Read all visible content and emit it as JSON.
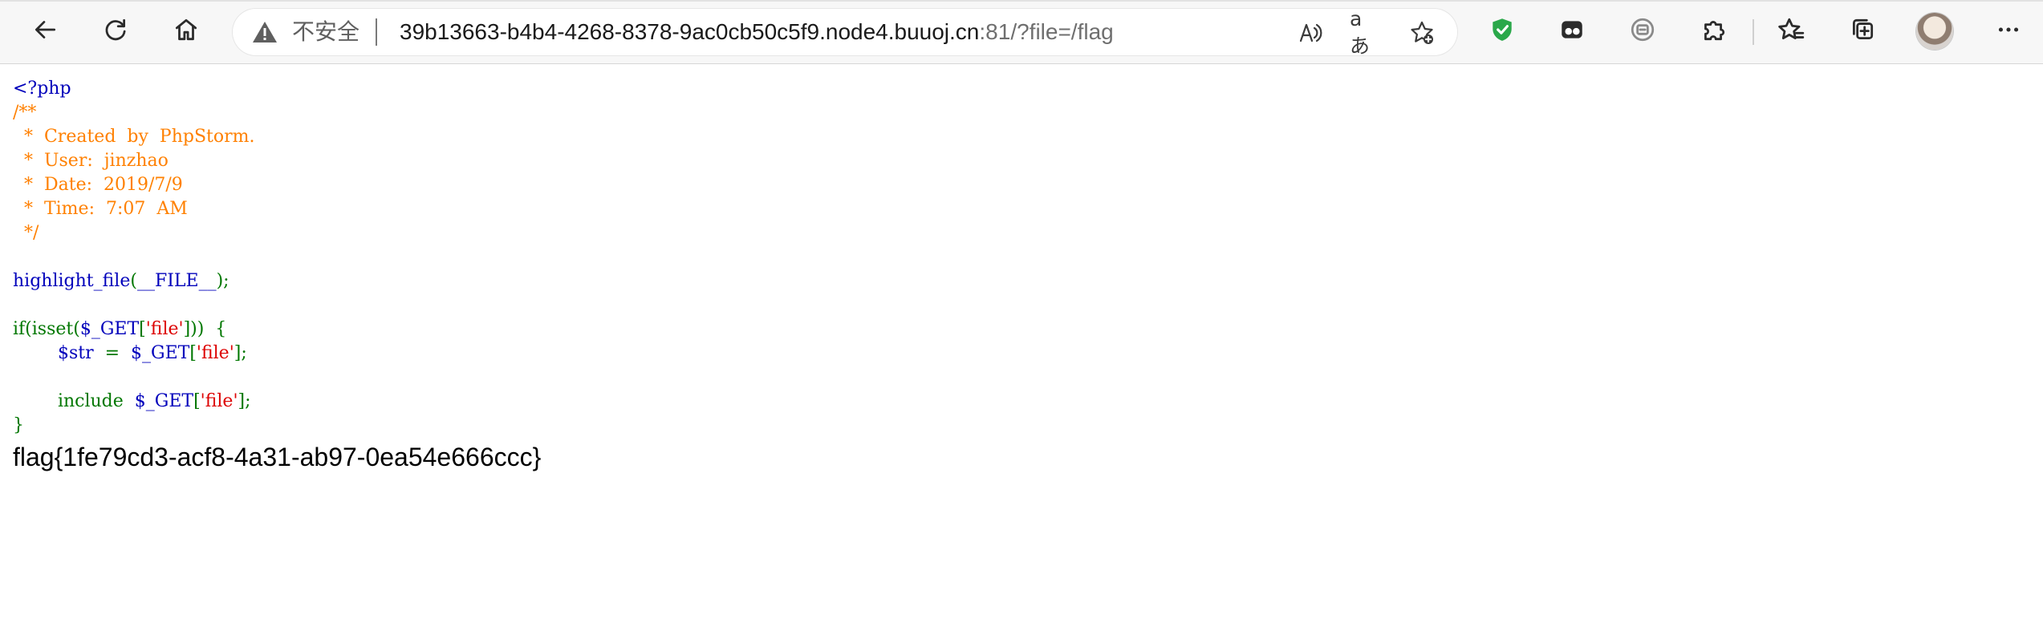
{
  "browser": {
    "security_label": "不安全",
    "url_host": "39b13663-b4b4-4268-8378-9ac0cb50c5f9.node4.buuoj.cn",
    "url_rest": ":81/?file=/flag",
    "icons": {
      "back": "back-arrow-icon",
      "refresh": "refresh-icon",
      "home": "home-icon",
      "warning": "warning-triangle-icon",
      "read_aloud": "read-aloud-icon",
      "translate": "translate-icon",
      "add_favorite": "add-favorite-icon",
      "shield_extension": "shield-icon",
      "extension_one": "tab-extension-icon",
      "extension_two": "circle-extension-icon",
      "extensions": "puzzle-icon",
      "favorites": "favorites-icon",
      "collections": "collections-icon",
      "profile": "profile-avatar",
      "more": "more-icon"
    },
    "colors": {
      "toolbar_bg": "#f7f7f7",
      "shield_green": "#2aa84a"
    }
  },
  "source": {
    "colors": {
      "default": "#0000bb",
      "comment": "#ff8000",
      "keyword": "#007700",
      "string": "#dd0000"
    },
    "lines": [
      [
        {
          "t": "<?php",
          "c": "default"
        }
      ],
      [
        {
          "t": "/**",
          "c": "comment"
        }
      ],
      [
        {
          "t": "  *  Created  by  PhpStorm.",
          "c": "comment"
        }
      ],
      [
        {
          "t": "  *  User:  jinzhao",
          "c": "comment"
        }
      ],
      [
        {
          "t": "  *  Date:  2019/7/9",
          "c": "comment"
        }
      ],
      [
        {
          "t": "  *  Time:  7:07  AM",
          "c": "comment"
        }
      ],
      [
        {
          "t": "  */",
          "c": "comment"
        }
      ],
      [
        {
          "t": "",
          "c": "default"
        }
      ],
      [
        {
          "t": "highlight_file",
          "c": "default"
        },
        {
          "t": "(",
          "c": "keyword"
        },
        {
          "t": "__FILE__",
          "c": "default"
        },
        {
          "t": ");",
          "c": "keyword"
        }
      ],
      [
        {
          "t": "",
          "c": "default"
        }
      ],
      [
        {
          "t": "if(isset(",
          "c": "keyword"
        },
        {
          "t": "$_GET",
          "c": "default"
        },
        {
          "t": "[",
          "c": "keyword"
        },
        {
          "t": "'file'",
          "c": "string"
        },
        {
          "t": "]))  {",
          "c": "keyword"
        }
      ],
      [
        {
          "t": "        ",
          "c": "keyword"
        },
        {
          "t": "$str  ",
          "c": "default"
        },
        {
          "t": "=  ",
          "c": "keyword"
        },
        {
          "t": "$_GET",
          "c": "default"
        },
        {
          "t": "[",
          "c": "keyword"
        },
        {
          "t": "'file'",
          "c": "string"
        },
        {
          "t": "];",
          "c": "keyword"
        }
      ],
      [
        {
          "t": "",
          "c": "default"
        }
      ],
      [
        {
          "t": "        include  ",
          "c": "keyword"
        },
        {
          "t": "$_GET",
          "c": "default"
        },
        {
          "t": "[",
          "c": "keyword"
        },
        {
          "t": "'file'",
          "c": "string"
        },
        {
          "t": "];",
          "c": "keyword"
        }
      ],
      [
        {
          "t": "}",
          "c": "keyword"
        }
      ]
    ]
  },
  "output": {
    "flag": "flag{1fe79cd3-acf8-4a31-ab97-0ea54e666ccc}"
  }
}
